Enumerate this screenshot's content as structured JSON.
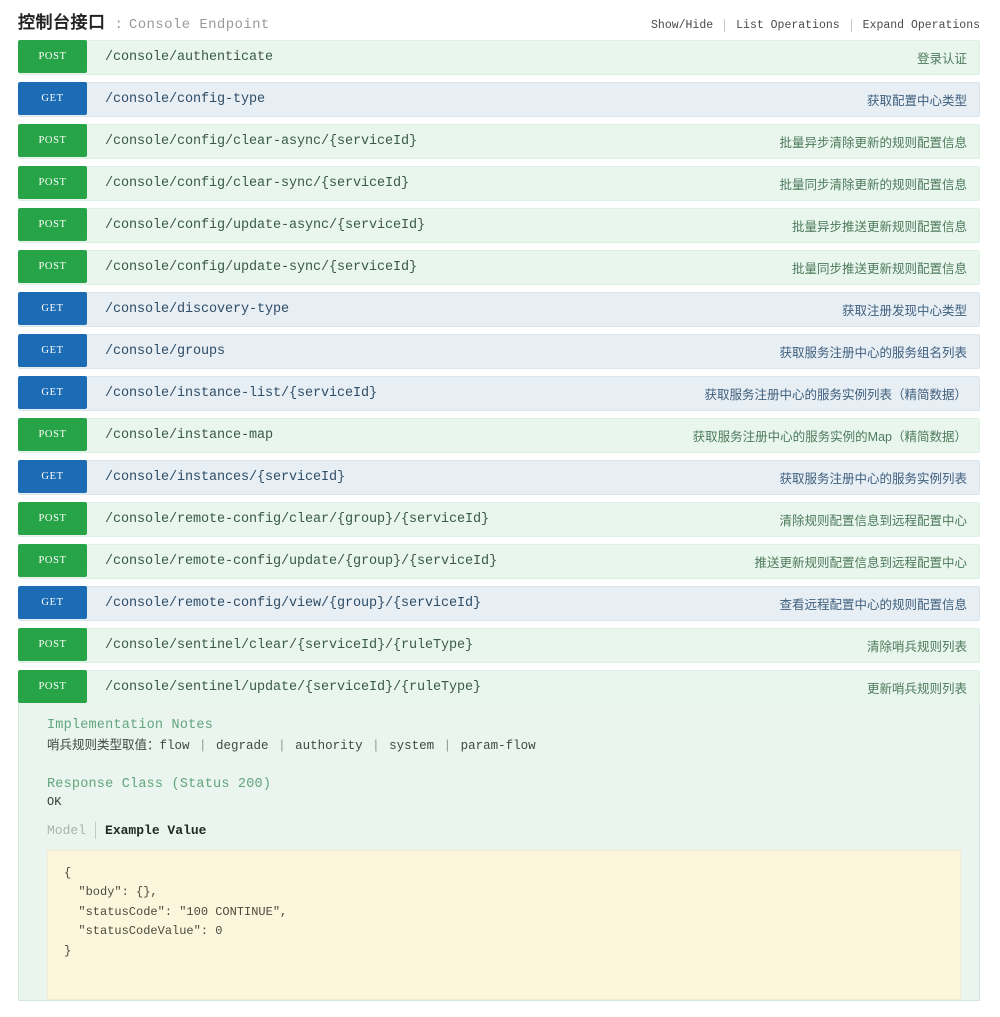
{
  "header": {
    "title_cn": "控制台接口",
    "separator": ":",
    "title_en": "Console Endpoint",
    "options": {
      "show_hide": "Show/Hide",
      "list_operations": "List Operations",
      "expand_operations": "Expand Operations"
    }
  },
  "operations": [
    {
      "method": "POST",
      "path": "/console/authenticate",
      "description": "登录认证"
    },
    {
      "method": "GET",
      "path": "/console/config-type",
      "description": "获取配置中心类型"
    },
    {
      "method": "POST",
      "path": "/console/config/clear-async/{serviceId}",
      "description": "批量异步清除更新的规则配置信息"
    },
    {
      "method": "POST",
      "path": "/console/config/clear-sync/{serviceId}",
      "description": "批量同步清除更新的规则配置信息"
    },
    {
      "method": "POST",
      "path": "/console/config/update-async/{serviceId}",
      "description": "批量异步推送更新规则配置信息"
    },
    {
      "method": "POST",
      "path": "/console/config/update-sync/{serviceId}",
      "description": "批量同步推送更新规则配置信息"
    },
    {
      "method": "GET",
      "path": "/console/discovery-type",
      "description": "获取注册发现中心类型"
    },
    {
      "method": "GET",
      "path": "/console/groups",
      "description": "获取服务注册中心的服务组名列表"
    },
    {
      "method": "GET",
      "path": "/console/instance-list/{serviceId}",
      "description": "获取服务注册中心的服务实例列表（精简数据）"
    },
    {
      "method": "POST",
      "path": "/console/instance-map",
      "description": "获取服务注册中心的服务实例的Map（精简数据）"
    },
    {
      "method": "GET",
      "path": "/console/instances/{serviceId}",
      "description": "获取服务注册中心的服务实例列表"
    },
    {
      "method": "POST",
      "path": "/console/remote-config/clear/{group}/{serviceId}",
      "description": "清除规则配置信息到远程配置中心"
    },
    {
      "method": "POST",
      "path": "/console/remote-config/update/{group}/{serviceId}",
      "description": "推送更新规则配置信息到远程配置中心"
    },
    {
      "method": "GET",
      "path": "/console/remote-config/view/{group}/{serviceId}",
      "description": "查看远程配置中心的规则配置信息"
    },
    {
      "method": "POST",
      "path": "/console/sentinel/clear/{serviceId}/{ruleType}",
      "description": "清除哨兵规则列表"
    },
    {
      "method": "POST",
      "path": "/console/sentinel/update/{serviceId}/{ruleType}",
      "description": "更新哨兵规则列表"
    }
  ],
  "detail": {
    "implementation_notes_label": "Implementation Notes",
    "implementation_notes_prefix": "哨兵规则类型取值：",
    "rule_types": [
      "flow",
      "degrade",
      "authority",
      "system",
      "param-flow"
    ],
    "response_class_label": "Response Class (Status 200)",
    "response_ok": "OK",
    "tab_model": "Model",
    "tab_example": "Example Value",
    "example_value": "{\n  \"body\": {},\n  \"statusCode\": \"100 CONTINUE\",\n  \"statusCodeValue\": 0\n}"
  },
  "colors": {
    "get_badge": "#1b6cb5",
    "post_badge": "#27a447",
    "get_row_bg": "#e7eef4",
    "post_row_bg": "#e8f6ed",
    "detail_bg": "#e9f5ee",
    "example_bg": "#fcf6dc",
    "heading_green": "#63a47e"
  }
}
